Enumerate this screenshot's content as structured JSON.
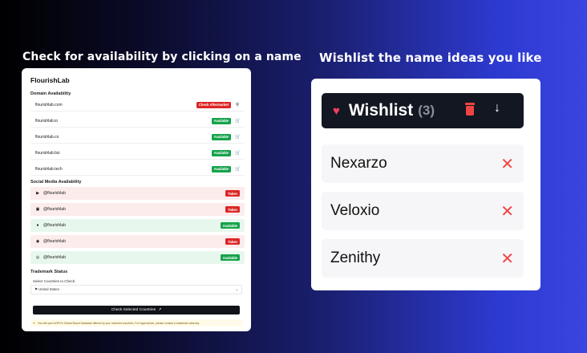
{
  "headings": {
    "left": "Check for availability by clicking on a name",
    "right": "Wishlist the name ideas you like"
  },
  "left_panel": {
    "brand": "FlourishLab",
    "domain_section": {
      "title": "Domain Availability",
      "rows": [
        {
          "name": "flourishlab.com",
          "status": "Check Aftermarket",
          "status_color": "#dc2626",
          "icon": "search-icon"
        },
        {
          "name": "flourishlab.io",
          "status": "Available",
          "status_color": "#16a34a",
          "icon": "cart-icon"
        },
        {
          "name": "flourishlab.co",
          "status": "Available",
          "status_color": "#16a34a",
          "icon": "cart-icon"
        },
        {
          "name": "flourishlab.biz",
          "status": "Available",
          "status_color": "#16a34a",
          "icon": "cart-icon"
        },
        {
          "name": "flourishlab.tech",
          "status": "Available",
          "status_color": "#16a34a",
          "icon": "cart-icon"
        }
      ]
    },
    "social_section": {
      "title": "Social Media Availability",
      "rows": [
        {
          "platform_icon": "youtube-icon",
          "handle": "@flourishlab",
          "status": "Taken",
          "status_color": "#dc2626"
        },
        {
          "platform_icon": "linkedin-icon",
          "handle": "@flourishlab",
          "status": "Taken",
          "status_color": "#dc2626"
        },
        {
          "platform_icon": "github-icon",
          "handle": "@flourishlab",
          "status": "Available",
          "status_color": "#16a34a"
        },
        {
          "platform_icon": "reddit-icon",
          "handle": "@flourishlab",
          "status": "Taken",
          "status_color": "#dc2626"
        },
        {
          "platform_icon": "dribbble-icon",
          "handle": "@flourishlab",
          "status": "Available",
          "status_color": "#16a34a"
        }
      ]
    },
    "trademark_section": {
      "title": "Trademark Status",
      "select_label": "Select Countries to Check:",
      "selected_country": "United States",
      "check_button": "Check Selected Countries",
      "note": "You will open WIPO's Global Brand Database filtered by your selected countries. For legal advice, please consult a trademark attorney."
    }
  },
  "wishlist": {
    "title": "Wishlist",
    "count": "(3)",
    "items": [
      "Nexarzo",
      "Veloxio",
      "Zenithy"
    ],
    "accent_color": "#ef4444"
  }
}
